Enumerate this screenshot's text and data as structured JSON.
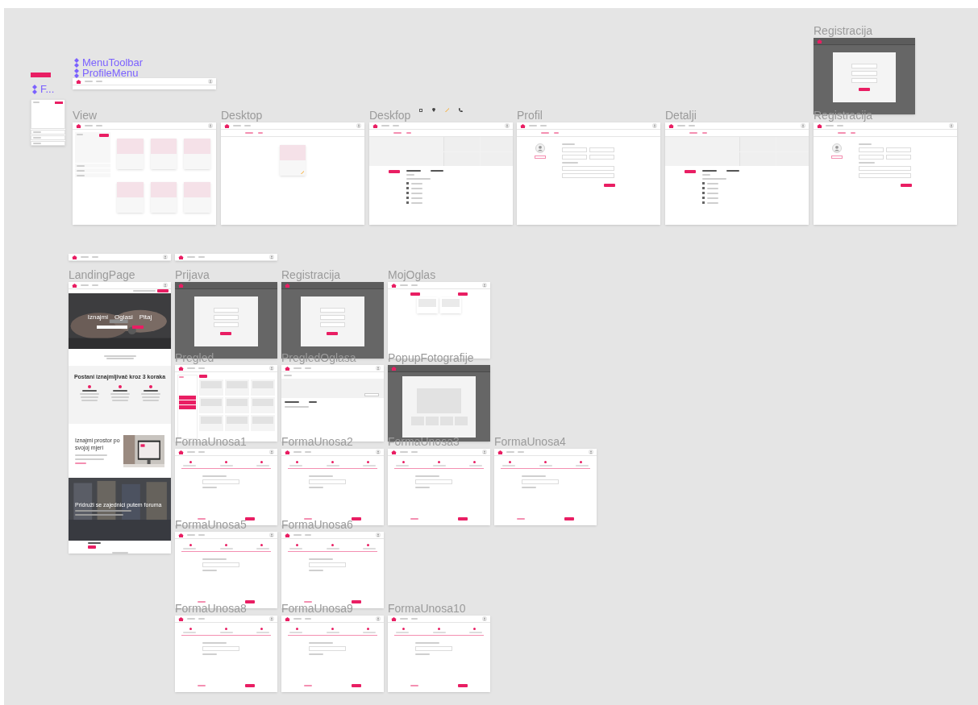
{
  "components": [
    {
      "title": "MenuToolbar"
    },
    {
      "title": "ProfileMenu"
    },
    {
      "title": "F..."
    }
  ],
  "frames": [
    {
      "title": "Registracija",
      "kind": "modal"
    },
    {
      "kind": "component-panel"
    },
    {
      "kind": "navbar"
    },
    {
      "title": "View",
      "kind": "grid"
    },
    {
      "title": "Desktop",
      "kind": "single-card"
    },
    {
      "title": "Deskfop",
      "kind": "details"
    },
    {
      "title": "Profil",
      "kind": "profile"
    },
    {
      "title": "Detalji",
      "kind": "details"
    },
    {
      "title": "Registracija",
      "kind": "profile"
    },
    {
      "kind": "navbar"
    },
    {
      "kind": "navbar"
    },
    {
      "title": "LandingPage",
      "kind": "landing",
      "hero_links": [
        "Iznajmi",
        "Oglasi",
        "Pitaj"
      ],
      "steps_heading": "Postani iznajmljivač kroz 3 koraka",
      "space_heading": "Iznajmi prostor po svojoj mjeri",
      "forum_heading": "Pridruži se zajednici putem foruma"
    },
    {
      "title": "Prijava",
      "kind": "modal"
    },
    {
      "title": "Registracija",
      "kind": "modal"
    },
    {
      "title": "MojOglas",
      "kind": "cards"
    },
    {
      "title": "Pregled",
      "kind": "browse"
    },
    {
      "title": "PregledOglasa",
      "kind": "ad-view"
    },
    {
      "title": "PopupFotografije",
      "kind": "photo-popup"
    },
    {
      "title": "FormaUnosa1",
      "kind": "form"
    },
    {
      "title": "FormaUnosa2",
      "kind": "form"
    },
    {
      "title": "FormaUnosa3",
      "kind": "form"
    },
    {
      "title": "FormaUnosa4",
      "kind": "form"
    },
    {
      "title": "FormaUnosa5",
      "kind": "form"
    },
    {
      "title": "FormaUnosa6",
      "kind": "form"
    },
    {
      "title": "FormaUnosa8",
      "kind": "form"
    },
    {
      "title": "FormaUnosa9",
      "kind": "form"
    },
    {
      "title": "FormaUnosa10",
      "kind": "form"
    }
  ]
}
